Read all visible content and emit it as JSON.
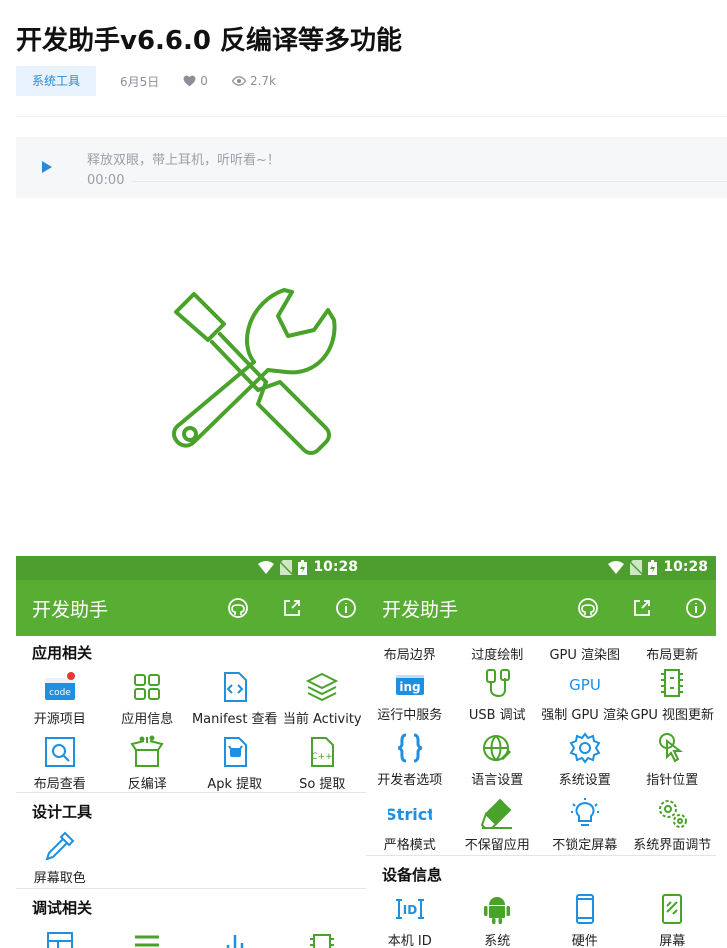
{
  "article": {
    "title": "开发助手v6.6.0 反编译等多功能",
    "tag": "系统工具",
    "date": "6月5日",
    "likes": "0",
    "views": "2.7k"
  },
  "player": {
    "hint": "释放双眼，带上耳机，听听看~！",
    "time": "00:00"
  },
  "colors": {
    "accent": "#58ad33",
    "statusbar": "#4e9e2f",
    "icon_blue": "#1f8fe0",
    "icon_green": "#49a229",
    "tag_bg": "#e8f3fd",
    "tag_text": "#2a88d8"
  },
  "phone_left": {
    "status_time": "10:28",
    "app_title": "开发助手",
    "actions": [
      "github-icon",
      "share-icon",
      "info-icon"
    ],
    "sections": [
      {
        "title": "应用相关",
        "items": [
          {
            "label": "开源项目",
            "icon": "code-icon"
          },
          {
            "label": "应用信息",
            "icon": "grid-icon"
          },
          {
            "label": "Manifest 查看",
            "icon": "file-code-icon"
          },
          {
            "label": "当前 Activity",
            "icon": "layers-icon"
          },
          {
            "label": "布局查看",
            "icon": "inspect-icon"
          },
          {
            "label": "反编译",
            "icon": "open-box-icon"
          },
          {
            "label": "Apk 提取",
            "icon": "apk-file-icon"
          },
          {
            "label": "So 提取",
            "icon": "cpp-file-icon"
          }
        ]
      },
      {
        "title": "设计工具",
        "items": [
          {
            "label": "屏幕取色",
            "icon": "color-picker-icon"
          }
        ]
      },
      {
        "title": "调试相关",
        "items": []
      }
    ]
  },
  "phone_right": {
    "status_time": "10:28",
    "app_title": "开发助手",
    "actions": [
      "github-icon",
      "share-icon",
      "info-icon"
    ],
    "top_labels": [
      "布局边界",
      "过度绘制",
      "GPU 渲染图",
      "布局更新"
    ],
    "items": [
      {
        "label": "运行中服务",
        "icon": "ing-icon"
      },
      {
        "label": "USB 调试",
        "icon": "usb-icon"
      },
      {
        "label": "强制 GPU 渲染",
        "icon": "gpu-icon"
      },
      {
        "label": "GPU 视图更新",
        "icon": "chip-icon"
      },
      {
        "label": "开发者选项",
        "icon": "braces-icon"
      },
      {
        "label": "语言设置",
        "icon": "globe-icon"
      },
      {
        "label": "系统设置",
        "icon": "gear-icon"
      },
      {
        "label": "指针位置",
        "icon": "touch-icon"
      },
      {
        "label": "严格模式",
        "icon": "strict-icon"
      },
      {
        "label": "不保留应用",
        "icon": "eraser-icon"
      },
      {
        "label": "不锁定屏幕",
        "icon": "bulb-icon"
      },
      {
        "label": "系统界面调节",
        "icon": "gears-icon"
      }
    ],
    "strict_text": "Strict",
    "gpu_text": "GPU",
    "ing_text": "ing",
    "device_section": {
      "title": "设备信息",
      "items": [
        {
          "label": "本机 ID",
          "icon": "id-icon"
        },
        {
          "label": "系统",
          "icon": "android-icon"
        },
        {
          "label": "硬件",
          "icon": "phone-icon"
        },
        {
          "label": "屏幕",
          "icon": "screen-icon"
        }
      ]
    }
  }
}
